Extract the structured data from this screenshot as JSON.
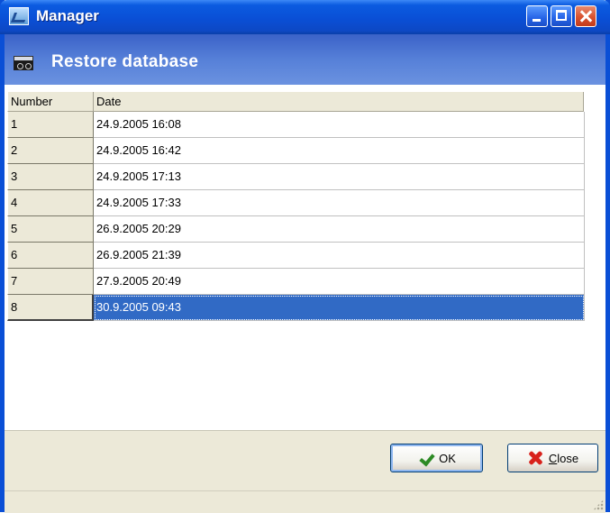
{
  "window": {
    "title": "Manager"
  },
  "header": {
    "title": "Restore database",
    "icon": "database-icon"
  },
  "grid": {
    "columns": [
      "Number",
      "Date"
    ],
    "rows": [
      {
        "number": "1",
        "date": "24.9.2005 16:08"
      },
      {
        "number": "2",
        "date": "24.9.2005 16:42"
      },
      {
        "number": "3",
        "date": "24.9.2005 17:13"
      },
      {
        "number": "4",
        "date": "24.9.2005 17:33"
      },
      {
        "number": "5",
        "date": "26.9.2005 20:29"
      },
      {
        "number": "6",
        "date": "26.9.2005 21:39"
      },
      {
        "number": "7",
        "date": "27.9.2005 20:49"
      },
      {
        "number": "8",
        "date": "30.9.2005 09:43"
      }
    ],
    "selected_number": "8"
  },
  "footer": {
    "ok_label": "OK",
    "close_label": "Close"
  },
  "colors": {
    "titlebar": "#0a4fd6",
    "header": "#5680d8",
    "selection": "#316ac5"
  }
}
